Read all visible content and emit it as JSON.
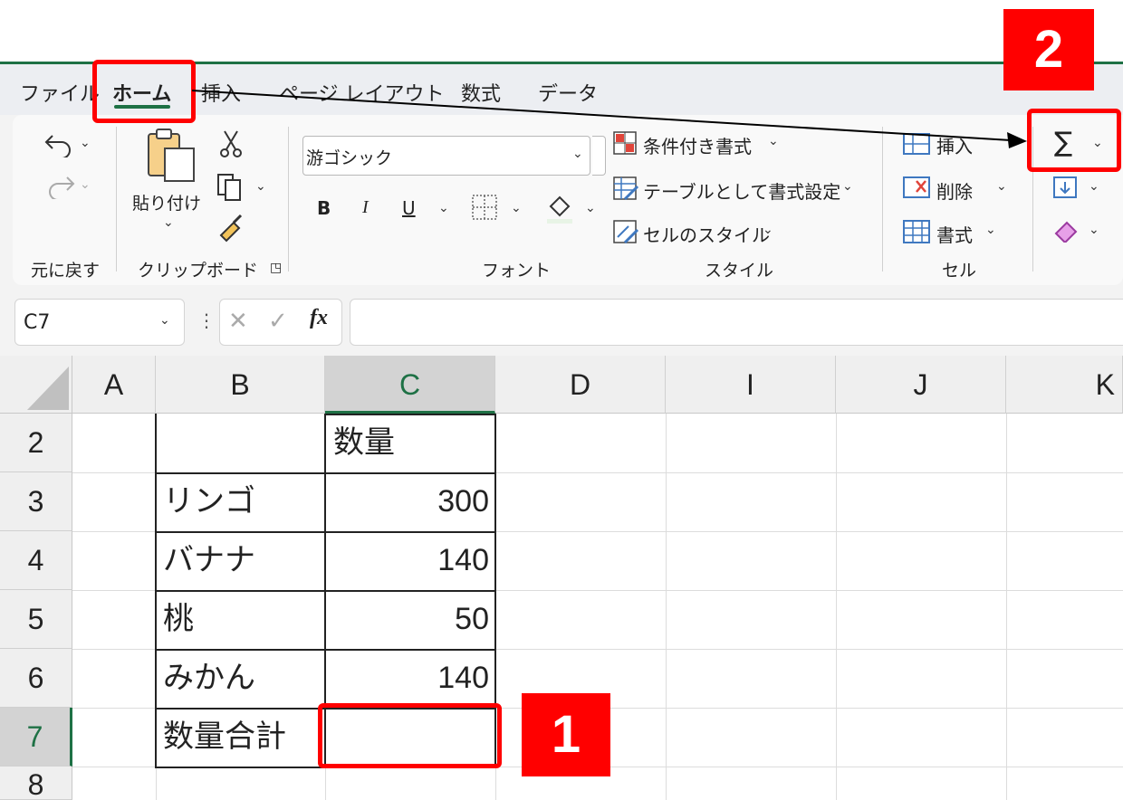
{
  "tabs": [
    "ファイル",
    "ホーム",
    "挿入",
    "ページ レイアウト",
    "数式",
    "データ"
  ],
  "ribbon": {
    "undo_group_label": "元に戻す",
    "clipboard": {
      "paste_label": "貼り付け",
      "group_label": "クリップボード"
    },
    "font": {
      "name": "游ゴシック",
      "bold": "B",
      "italic": "I",
      "underline": "U",
      "group_label": "フォント"
    },
    "styles": {
      "conditional": "条件付き書式",
      "table": "テーブルとして書式設定",
      "cell_style": "セルのスタイル",
      "group_label": "スタイル"
    },
    "cells": {
      "insert": "挿入",
      "delete": "削除",
      "format": "書式",
      "group_label": "セル"
    },
    "editing": {
      "sum_symbol": "∑"
    }
  },
  "formula_bar": {
    "name_box": "C7",
    "fx": "fx",
    "formula": ""
  },
  "columns": [
    "A",
    "B",
    "C",
    "D",
    "I",
    "J",
    "K"
  ],
  "selected_column": "C",
  "rows": [
    {
      "num": "2",
      "b": "",
      "c": "数量"
    },
    {
      "num": "3",
      "b": "リンゴ",
      "c": "300"
    },
    {
      "num": "4",
      "b": "バナナ",
      "c": "140"
    },
    {
      "num": "5",
      "b": "桃",
      "c": "50"
    },
    {
      "num": "6",
      "b": "みかん",
      "c": "140"
    },
    {
      "num": "7",
      "b": "数量合計",
      "c": ""
    },
    {
      "num": "8",
      "b": "",
      "c": ""
    }
  ],
  "selected_row": "7",
  "annotations": {
    "step1": "1",
    "step2": "2"
  },
  "colors": {
    "accent_green": "#1e7145",
    "annotation_red": "#ff0000"
  }
}
